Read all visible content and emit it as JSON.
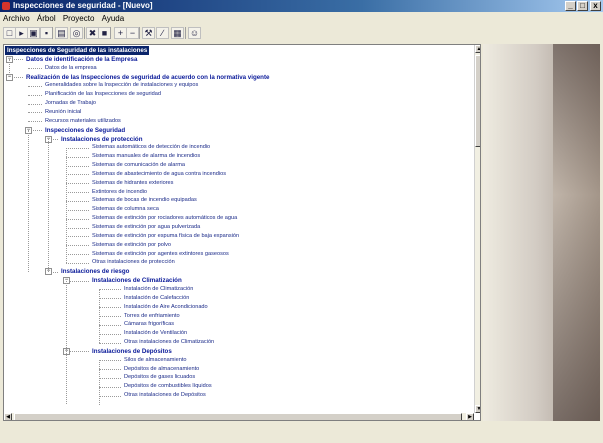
{
  "window": {
    "title": "Inspecciones de seguridad - [Nuevo]",
    "controls": [
      "_",
      "□",
      "x"
    ]
  },
  "menu": [
    "Archivo",
    "Árbol",
    "Proyecto",
    "Ayuda"
  ],
  "toolbar": {
    "buttons": [
      {
        "name": "new-icon",
        "glyph": "□"
      },
      {
        "name": "open-icon",
        "glyph": "▸"
      },
      {
        "name": "folder-icon",
        "glyph": "▣"
      },
      {
        "name": "save-icon",
        "glyph": "▪"
      },
      {
        "name": "page-icon",
        "glyph": "▤"
      },
      {
        "name": "binoculars-icon",
        "glyph": "◎"
      },
      {
        "name": "delete-icon",
        "glyph": "✖"
      },
      {
        "name": "stop-icon",
        "glyph": "■"
      },
      {
        "name": "add-icon",
        "glyph": "+"
      },
      {
        "name": "remove-icon",
        "glyph": "−"
      },
      {
        "name": "tool-icon",
        "glyph": "⚒"
      },
      {
        "name": "edit-icon",
        "glyph": "∕"
      },
      {
        "name": "chart-icon",
        "glyph": "▦"
      },
      {
        "name": "help-icon",
        "glyph": "☺"
      }
    ]
  },
  "tree": [
    {
      "label": "Inspecciones de Seguridad de las instalaciones",
      "level": 0,
      "type": "root"
    },
    {
      "label": "Datos de identificación de la Empresa",
      "level": 1,
      "type": "group"
    },
    {
      "label": "Datos de la empresa",
      "level": 2,
      "type": "leaf"
    },
    {
      "label": "Realización de las Inspecciones de seguridad de acuerdo con la normativa vigente",
      "level": 1,
      "type": "group"
    },
    {
      "label": "Generalidades sobre la Inspección de instalaciones y equipos",
      "level": 2,
      "type": "leaf"
    },
    {
      "label": "Planificación de las Inspecciones de seguridad",
      "level": 2,
      "type": "leaf"
    },
    {
      "label": "Jornadas de Trabajo",
      "level": 2,
      "type": "leaf"
    },
    {
      "label": "Reunión inicial",
      "level": 2,
      "type": "leaf"
    },
    {
      "label": "Recursos materiales utilizados",
      "level": 2,
      "type": "leaf"
    },
    {
      "label": "Inspecciones de Seguridad",
      "level": 2,
      "type": "group"
    },
    {
      "label": "Instalaciones de protección",
      "level": 3,
      "type": "group"
    },
    {
      "label": "Sistemas automáticos de detección de incendio",
      "level": 4,
      "type": "leaf"
    },
    {
      "label": "Sistemas manuales de alarma de incendios",
      "level": 4,
      "type": "leaf"
    },
    {
      "label": "Sistemas de comunicación de alarma",
      "level": 4,
      "type": "leaf"
    },
    {
      "label": "Sistemas de abastecimiento de agua contra incendios",
      "level": 4,
      "type": "leaf"
    },
    {
      "label": "Sistemas de hidrantes exteriores",
      "level": 4,
      "type": "leaf"
    },
    {
      "label": "Extintores de incendio",
      "level": 4,
      "type": "leaf"
    },
    {
      "label": "Sistemas de bocas de incendio equipadas",
      "level": 4,
      "type": "leaf"
    },
    {
      "label": "Sistemas de columna seca",
      "level": 4,
      "type": "leaf"
    },
    {
      "label": "Sistemas de extinción por rociadores automáticos de agua",
      "level": 4,
      "type": "leaf"
    },
    {
      "label": "Sistemas de extinción por agua pulverizada",
      "level": 4,
      "type": "leaf"
    },
    {
      "label": "Sistemas de extinción por espuma física de baja expansión",
      "level": 4,
      "type": "leaf"
    },
    {
      "label": "Sistemas de extinción por polvo",
      "level": 4,
      "type": "leaf"
    },
    {
      "label": "Sistemas de extinción por agentes extintores gaseosos",
      "level": 4,
      "type": "leaf"
    },
    {
      "label": "Otras instalaciones de protección",
      "level": 4,
      "type": "leaf"
    },
    {
      "label": "Instalaciones de riesgo",
      "level": 3,
      "type": "group"
    },
    {
      "label": "Instalaciones de Climatización",
      "level": 4,
      "type": "group"
    },
    {
      "label": "Instalación de Climatización",
      "level": 5,
      "type": "leaf"
    },
    {
      "label": "Instalación de Calefacción",
      "level": 5,
      "type": "leaf"
    },
    {
      "label": "Instalación de Aire Acondicionado",
      "level": 5,
      "type": "leaf"
    },
    {
      "label": "Torres de enfriamiento",
      "level": 5,
      "type": "leaf"
    },
    {
      "label": "Cámaras frigoríficas",
      "level": 5,
      "type": "leaf"
    },
    {
      "label": "Instalación de Ventilación",
      "level": 5,
      "type": "leaf"
    },
    {
      "label": "Otras instalaciones de Climatización",
      "level": 5,
      "type": "leaf"
    },
    {
      "label": "Instalaciones de Depósitos",
      "level": 4,
      "type": "group"
    },
    {
      "label": "Silos de almacenamiento",
      "level": 5,
      "type": "leaf"
    },
    {
      "label": "Depósitos de almacenamiento",
      "level": 5,
      "type": "leaf"
    },
    {
      "label": "Depósitos de gases licuados",
      "level": 5,
      "type": "leaf"
    },
    {
      "label": "Depósitos de combustibles líquidos",
      "level": 5,
      "type": "leaf"
    },
    {
      "label": "Otras instalaciones de Depósitos",
      "level": 5,
      "type": "leaf"
    }
  ],
  "scroll": {
    "vertical_position": 0.0,
    "vertical_visible_fraction": 0.25
  },
  "colors": {
    "title_active": "#0a246a",
    "tree_text": "#1a2a88",
    "selection": "#0a246a"
  }
}
